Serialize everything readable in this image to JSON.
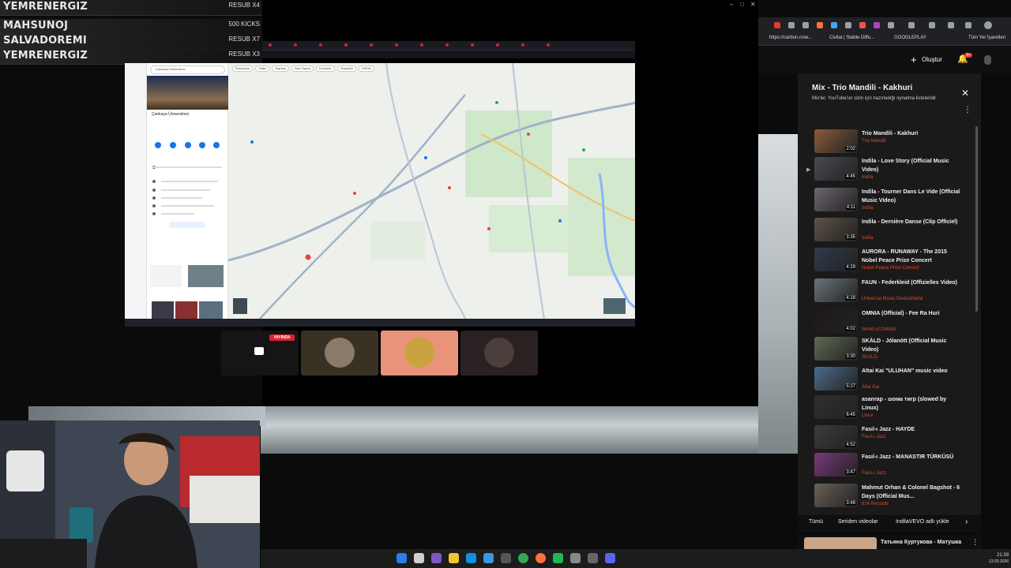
{
  "leaderboard": [
    {
      "name": "YEMRENERGIZ",
      "badge": "RESUB X4"
    },
    {
      "name": "MAHSUNOJ",
      "badge": "500 KICKS"
    },
    {
      "name": "SALVADOREMI",
      "badge": "RESUB X7"
    },
    {
      "name": "YEMRENERGIZ",
      "badge": "RESUB X3"
    }
  ],
  "maps": {
    "search_placeholder": "Çankaya Üniversitesi",
    "place_title": "Çankaya Üniversitesi",
    "chips": [
      "Restoranlar",
      "Oteller",
      "Alışveriş",
      "Toplu Taşıma",
      "Eczaneler",
      "Otoparklar",
      "ATM'ler"
    ]
  },
  "call": {
    "live_label": "YAYINDA"
  },
  "browser": {
    "bookmarks": [
      "https://carbon.now...",
      "Civitai | Stable Diffu...",
      "GOOGLEPLAY",
      "Tüm Yer İşaretleri"
    ],
    "create_label": "Oluştur",
    "notification_count": "9+"
  },
  "playlist": {
    "title": "Mix - Trio Mandili - Kakhuri",
    "subtitle": "Mix'ler, YouTube'un sizin için hazırladığı oynatma listeleridir",
    "items": [
      {
        "title": "Trio Mandili - Kakhuri",
        "channel": "Trio Mandili",
        "duration": "2:02",
        "color": "#8a5a3c"
      },
      {
        "title": "Indila - Love Story (Official Music Video)",
        "channel": "Indila",
        "duration": "4:45",
        "color": "#4a4a52"
      },
      {
        "title": "Indila - Tourner Dans Le Vide (Official Music Video)",
        "channel": "Indila",
        "duration": "4:11",
        "color": "#6d6670"
      },
      {
        "title": "Indila - Dernière Danse (Clip Officiel)",
        "channel": "Indila",
        "duration": "3:35",
        "color": "#5b5346"
      },
      {
        "title": "AURORA - RUNAWAY - The 2015 Nobel Peace Prize Concert",
        "channel": "Nobel Peace Prize Concert",
        "duration": "4:29",
        "color": "#303a4a"
      },
      {
        "title": "FAUN - Federkleid (Offizielles Video)",
        "channel": "Universal Music Deutschland",
        "duration": "4:18",
        "color": "#6a7478"
      },
      {
        "title": "OMNIA (Official) - Fee Ra Huri",
        "channel": "World of OMNIA",
        "duration": "4:02",
        "color": "#1e1a18"
      },
      {
        "title": "SKÁLD - Jólanótt (Official Music Video)",
        "channel": "SKÁLD",
        "duration": "3:30",
        "color": "#5e6a55"
      },
      {
        "title": "Altai Kai \"ULUHAN\" music video",
        "channel": "Altai Kai",
        "duration": "5:27",
        "color": "#4c6b8a"
      },
      {
        "title": "asanrap - шома тигр (slowed by Linux)",
        "channel": "Linux",
        "duration": "6:45",
        "color": "#2f2f2f"
      },
      {
        "title": "Fasıl-ı Jazz - HAYDE",
        "channel": "Fasıl-ı Jazz",
        "duration": "4:52",
        "color": "#3b3b3b"
      },
      {
        "title": "Fasıl-ı Jazz - MANASTIR TÜRKÜSÜ",
        "channel": "Fasıl-ı Jazz",
        "duration": "3:47",
        "color": "#7a3a7a"
      },
      {
        "title": "Mahmut Orhan & Colonel Bagshot - 6 Days (Official Mus...",
        "channel": "814 Records",
        "duration": "3:48",
        "color": "#6a6058"
      }
    ]
  },
  "chips": [
    "Tümü",
    "Seriden videolar",
    "IndilaVEVO adlı yükle"
  ],
  "next_video": {
    "title": "Татьяна Куртукова - Матушка"
  },
  "clock": {
    "time": "21:39",
    "date": "13.03.2026"
  }
}
